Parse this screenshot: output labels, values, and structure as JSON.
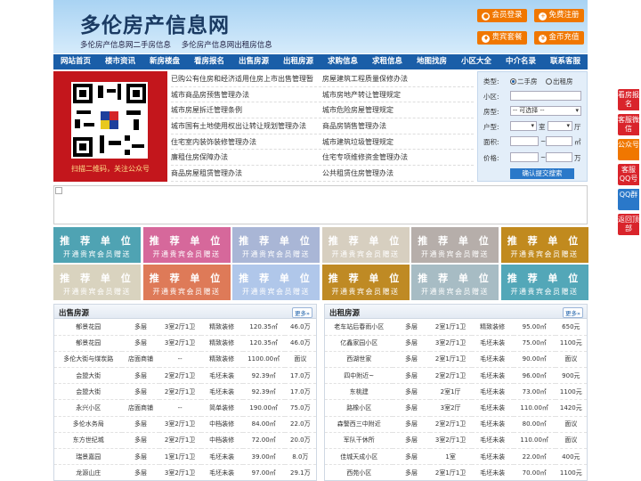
{
  "header": {
    "logo": "多伦房产信息网",
    "sublinks": [
      "多伦房产信息网二手房信息",
      "多伦房产信息网出租房信息"
    ],
    "buttons": [
      {
        "label": "会员登录",
        "icon": "user-icon"
      },
      {
        "label": "免费注册",
        "icon": "register-icon"
      },
      {
        "label": "贵宾套餐",
        "icon": "vip-icon"
      },
      {
        "label": "金币充值",
        "icon": "coin-icon"
      }
    ]
  },
  "nav": [
    "网站首页",
    "楼市资讯",
    "新房楼盘",
    "看房报名",
    "出售房源",
    "出租房源",
    "求购信息",
    "求租信息",
    "地图找房",
    "小区大全",
    "中介名录",
    "联系客服"
  ],
  "qr": {
    "caption": "扫描二维码，关注公众号"
  },
  "news": [
    [
      "已购公有住房和经济适用住房上市出售管理暂",
      "房屋建筑工程质量保修办法"
    ],
    [
      "城市商品房预售管理办法",
      "城市房地产转让管理规定"
    ],
    [
      "城市房屋拆迁管理条例",
      "城市危险房屋管理规定"
    ],
    [
      "城市国有土地使用权出让转让规划管理办法",
      "商品房销售管理办法"
    ],
    [
      "住宅室内装饰装修管理办法",
      "城市建筑垃圾管理规定"
    ],
    [
      "廉租住房保障办法",
      "住宅专项维修资金管理办法"
    ],
    [
      "商品房屋租赁管理办法",
      "公共租赁住房管理办法"
    ]
  ],
  "search": {
    "type_label": "类型:",
    "radio_sale": "二手房",
    "radio_rent": "出租房",
    "community_label": "小区:",
    "house_label": "房型:",
    "house_select": "-- 可选择 --",
    "layout_label": "户型:",
    "room_unit": "室",
    "hall_unit": "厅",
    "area_label": "面积:",
    "area_sep": "~",
    "area_unit": "㎡",
    "price_label": "价格:",
    "price_sep": "~",
    "price_unit": "万",
    "submit": "确认提交搜索"
  },
  "ads": {
    "line1": "推 荐 单 位",
    "line2": "开通贵宾会员赠送",
    "colors": [
      "#4fa3b3",
      "#d6689b",
      "#a9b6d6",
      "#d7cfc0",
      "#b6aeaa",
      "#c18a1e",
      "#d9d3bf",
      "#de7a58",
      "#b0c7ea",
      "#bf8a24",
      "#a7bcc4",
      "#53a7b8"
    ]
  },
  "sale": {
    "title": "出售房源",
    "more": "更多»",
    "rows": [
      [
        "郁景花园",
        "多层",
        "3室2厅1卫",
        "精致装修",
        "120.35㎡",
        "46.0万"
      ],
      [
        "郁景花园",
        "多层",
        "3室2厅1卫",
        "精致装修",
        "120.35㎡",
        "46.0万"
      ],
      [
        "多伦大街与煤炭路",
        "店面商铺",
        "--",
        "精致装修",
        "1100.00㎡",
        "面议"
      ],
      [
        "会盟大街",
        "多层",
        "2室2厅1卫",
        "毛坯未装",
        "92.39㎡",
        "17.0万"
      ],
      [
        "会盟大街",
        "多层",
        "2室2厅1卫",
        "毛坯未装",
        "92.39㎡",
        "17.0万"
      ],
      [
        "永兴小区",
        "店面商铺",
        "--",
        "简单装修",
        "190.00㎡",
        "75.0万"
      ],
      [
        "多伦水务局",
        "多层",
        "3室2厅1卫",
        "中档装修",
        "84.00㎡",
        "22.0万"
      ],
      [
        "东方世纪城",
        "多层",
        "2室2厅1卫",
        "中档装修",
        "72.00㎡",
        "20.0万"
      ],
      [
        "瑞景嘉园",
        "多层",
        "1室1厅1卫",
        "毛坯未装",
        "39.00㎡",
        "8.0万"
      ],
      [
        "龙源山庄",
        "多层",
        "3室2厅1卫",
        "毛坯未装",
        "97.00㎡",
        "29.1万"
      ]
    ]
  },
  "rent": {
    "title": "出租房源",
    "more": "更多»",
    "rows": [
      [
        "老车站后春雨小区",
        "多层",
        "2室1厅1卫",
        "精致装修",
        "95.00㎡",
        "650元"
      ],
      [
        "亿鑫家园小区",
        "多层",
        "3室2厅1卫",
        "毛坯未装",
        "75.00㎡",
        "1100元"
      ],
      [
        "西湖世家",
        "多层",
        "2室1厅1卫",
        "毛坯未装",
        "90.00㎡",
        "面议"
      ],
      [
        "四中附近~",
        "多层",
        "2室2厅1卫",
        "毛坯未装",
        "96.00㎡",
        "900元"
      ],
      [
        "东桃建",
        "多层",
        "2室1厅",
        "毛坯未装",
        "73.00㎡",
        "1100元"
      ],
      [
        "路橡小区",
        "多层",
        "3室2厅",
        "毛坯未装",
        "110.00㎡",
        "1420元"
      ],
      [
        "森警西三中附近",
        "多层",
        "2室2厅1卫",
        "毛坯未装",
        "80.00㎡",
        "面议"
      ],
      [
        "军队干休所",
        "多层",
        "3室2厅1卫",
        "毛坯未装",
        "110.00㎡",
        "面议"
      ],
      [
        "佳城天成小区",
        "多层",
        "1室",
        "毛坯未装",
        "22.00㎡",
        "400元"
      ],
      [
        "西苑小区",
        "多层",
        "2室1厅1卫",
        "毛坯未装",
        "70.00㎡",
        "1100元"
      ]
    ]
  },
  "float": [
    "看房报名",
    "客服微信",
    "公众号",
    "客服QQ号",
    "QQ群",
    "返回顶部"
  ]
}
